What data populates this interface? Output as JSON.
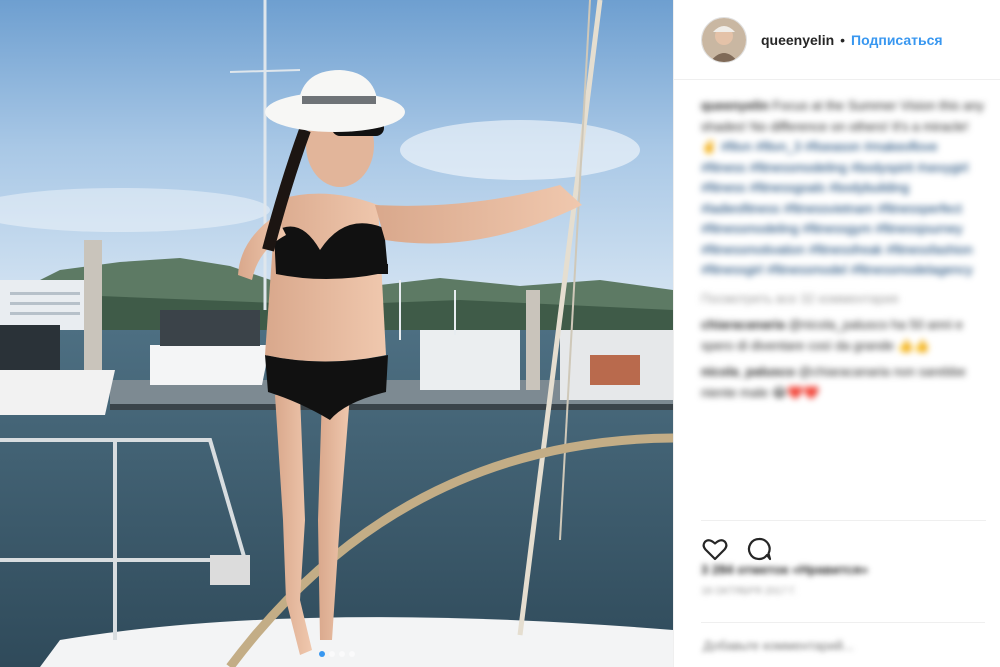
{
  "header": {
    "username": "queenyelin",
    "separator": "•",
    "follow_label": "Подписаться"
  },
  "caption": {
    "author": "queenyelin",
    "text": "Focus at the Summer Vision this any shades! No difference on others! It's a miracle! ✌️",
    "hashtags": "#fitvn #fitvn_3 #fiseason #makeoflove #fitness #fitnessmodeling #bodyspirit #sexygirl #fitness #fitnessgoals #bodybuilding #ladiesfitness #fitnessvietnam #fitnessperfect #fitnessmodeling #fitnessgym #fitnessjourney #fitnessmotivation #fitnessfreak #fitnessfashion #fitnessgirl #fitnessmodel #fitnessmodelagency"
  },
  "view_all_label": "Посмотреть все 32 комментария",
  "comments": [
    {
      "author": "chiaracanaria",
      "text": "@nicola_palusco ha 50 anni e spero di diventare così da grande 👍👍"
    },
    {
      "author": "nicola_palusco",
      "text": "@chiaracanaria non sarebbe niente male 😂❤️❤️"
    }
  ],
  "likes_label": "3 284 отметок «Нравится»",
  "date_label": "18 ОКТЯБРЯ 2017 Г.",
  "add_comment_placeholder": "Добавьте комментарий...",
  "colors": {
    "link": "#3897f0",
    "text": "#262626",
    "muted": "#999999",
    "border": "#efefef"
  },
  "icons": {
    "like": "heart-outline-icon",
    "comment": "comment-bubble-icon"
  },
  "carousel": {
    "count": 4,
    "active_index": 0
  }
}
